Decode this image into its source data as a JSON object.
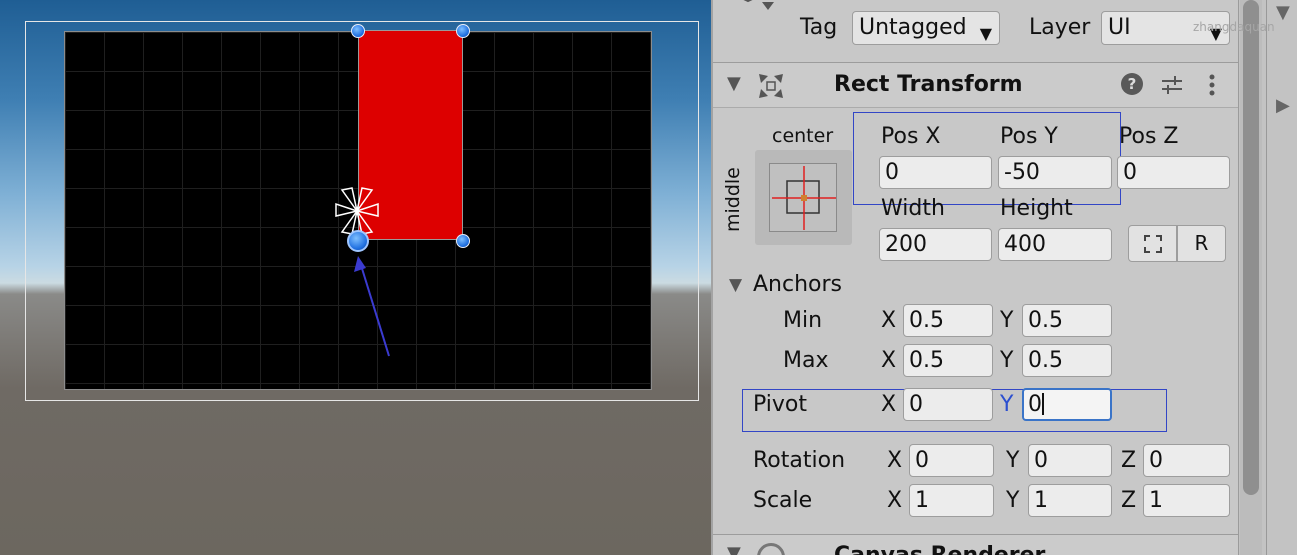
{
  "inspector": {
    "tag_label": "Tag",
    "tag_value": "Untagged",
    "layer_label": "Layer",
    "layer_value": "UI",
    "component_title": "Rect Transform",
    "anchor_preset": {
      "horizontal": "center",
      "vertical": "middle"
    },
    "pos_x_label": "Pos X",
    "pos_y_label": "Pos Y",
    "pos_z_label": "Pos Z",
    "pos_x": "0",
    "pos_y": "-50",
    "pos_z": "0",
    "width_label": "Width",
    "height_label": "Height",
    "width": "200",
    "height": "400",
    "raw_edit_label": "R",
    "anchors_label": "Anchors",
    "min_label": "Min",
    "max_label": "Max",
    "anchor_min": {
      "x": "0.5",
      "y": "0.5"
    },
    "anchor_max": {
      "x": "0.5",
      "y": "0.5"
    },
    "pivot_label": "Pivot",
    "pivot": {
      "x": "0",
      "y": "0"
    },
    "rotation_label": "Rotation",
    "rotation": {
      "x": "0",
      "y": "0",
      "z": "0"
    },
    "scale_label": "Scale",
    "scale": {
      "x": "1",
      "y": "1",
      "z": "1"
    },
    "axis_x": "X",
    "axis_y": "Y",
    "axis_z": "Z",
    "next_component_title": "Canvas Renderer"
  },
  "watermark": "zhangdaquan",
  "colors": {
    "selected_rect": "#dd0000",
    "highlight_box": "#3246c6",
    "handle_blue": "#1f6fe0",
    "active_field_border": "#3a74c8"
  },
  "icons": [
    "gameobject-cube-icon",
    "collapse-triangle-icon",
    "rect-transform-icon",
    "help-icon",
    "settings-sliders-icon",
    "more-vert-icon",
    "blueprint-mode-icon",
    "expand-arrow-icon"
  ]
}
